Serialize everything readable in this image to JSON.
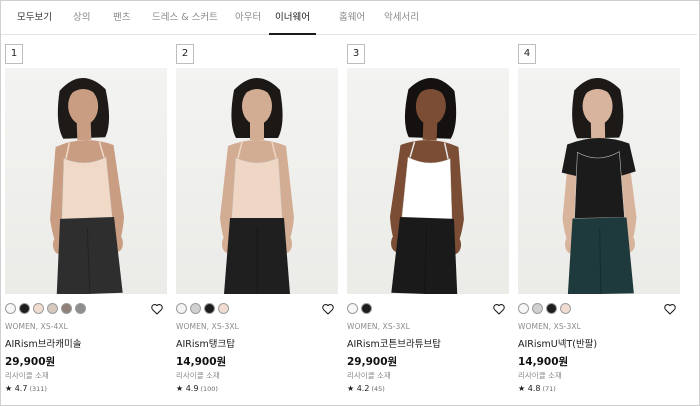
{
  "tabs": [
    {
      "label": "모두보기"
    },
    {
      "label": "상의"
    },
    {
      "label": "팬츠"
    },
    {
      "label": "드레스 & 스커트"
    },
    {
      "label": "아우터"
    },
    {
      "label": "이너웨어"
    },
    {
      "label": "홈웨어"
    },
    {
      "label": "악세서리"
    }
  ],
  "active_tab": "이너웨어",
  "icons": {
    "wishlist": "heart-outline-icon",
    "rating": "star-icon"
  },
  "products": [
    {
      "rank": "1",
      "image": {
        "top_color": "#f1d9c8",
        "bottom_color": "#2e2e2e",
        "skin": "#c99d82",
        "hair": "#1e1a17"
      },
      "swatches": [
        "#f7f7f7",
        "#1d1d1d",
        "#f1dcd0",
        "#d6c7bf",
        "#8f8178",
        "#8e8e8e"
      ],
      "meta": "WOMEN, XS-4XL",
      "name": "AIRism브라캐미솔",
      "price": "29,900원",
      "note": "리사이클 소재",
      "rating": "4.7",
      "reviews": "(311)"
    },
    {
      "rank": "2",
      "image": {
        "top_color": "#efd6c5",
        "bottom_color": "#1f1f1f",
        "skin": "#d3ad93",
        "hair": "#1b1816"
      },
      "swatches": [
        "#f4f4f4",
        "#d0d0d0",
        "#1d1d1d",
        "#f0dcd0"
      ],
      "meta": "WOMEN, XS-3XL",
      "name": "AIRism탱크탑",
      "price": "14,900원",
      "note": "리사이클 소재",
      "rating": "4.9",
      "reviews": "(100)"
    },
    {
      "rank": "3",
      "image": {
        "top_color": "#ffffff",
        "bottom_color": "#1a1a1a",
        "skin": "#7a4d34",
        "hair": "#141110"
      },
      "swatches": [
        "#f7f7f7",
        "#1d1d1d"
      ],
      "meta": "WOMEN, XS-3XL",
      "name": "AIRism코튼브라튜브탑",
      "price": "29,900원",
      "note": "리사이클 소재",
      "rating": "4.2",
      "reviews": "(45)"
    },
    {
      "rank": "4",
      "image": {
        "top_color": "#1b1b1b",
        "bottom_color": "#1e3a3c",
        "skin": "#d8b49d",
        "hair": "#1c1917"
      },
      "swatches": [
        "#f7f7f7",
        "#d0d0d0",
        "#1d1d1d",
        "#f0dcd0"
      ],
      "meta": "WOMEN, XS-3XL",
      "name": "AIRismU넥T(반팔)",
      "price": "14,900원",
      "note": "리사이클 소재",
      "rating": "4.8",
      "reviews": "(71)"
    }
  ]
}
